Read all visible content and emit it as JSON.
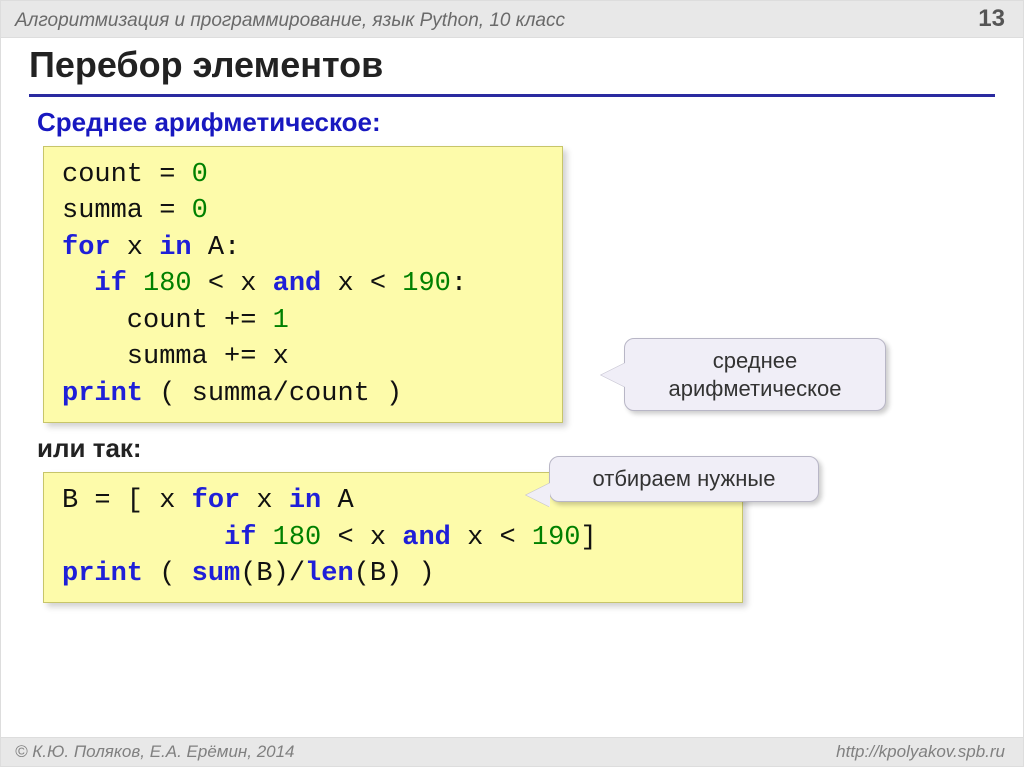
{
  "topbar": {
    "title": "Алгоритмизация и программирование, язык Python, 10 класс",
    "page": "13"
  },
  "heading": "Перебор элементов",
  "section_label": "Среднее арифметическое:",
  "or_label": "или так:",
  "code1": {
    "l1a": "count",
    "l1b": " = ",
    "l1c": "0",
    "l2a": "summa",
    "l2b": " = ",
    "l2c": "0",
    "l3a": "for",
    "l3b": " x ",
    "l3c": "in",
    "l3d": " A:",
    "l4a": "  ",
    "l4b": "if",
    "l4c": " ",
    "l4d": "180",
    "l4e": " < x ",
    "l4f": "and",
    "l4g": " x < ",
    "l4h": "190",
    "l4i": ":",
    "l5a": "    count += ",
    "l5b": "1",
    "l6a": "    summa += x",
    "l7a": "print",
    "l7b": " ( summa/count )"
  },
  "code2": {
    "l1a": "B = [ x ",
    "l1b": "for",
    "l1c": " x ",
    "l1d": "in",
    "l1e": " A",
    "l2a": "          ",
    "l2b": "if",
    "l2c": " ",
    "l2d": "180",
    "l2e": " < x ",
    "l2f": "and",
    "l2g": " x < ",
    "l2h": "190",
    "l2i": "]",
    "l3a": "print",
    "l3b": " ( ",
    "l3c": "sum",
    "l3d": "(B)/",
    "l3e": "len",
    "l3f": "(B) )"
  },
  "callouts": {
    "mean_l1": "среднее",
    "mean_l2": "арифметическое",
    "filter": "отбираем нужные"
  },
  "footer": {
    "left": "© К.Ю. Поляков, Е.А. Ерёмин, 2014",
    "right": "http://kpolyakov.spb.ru"
  }
}
